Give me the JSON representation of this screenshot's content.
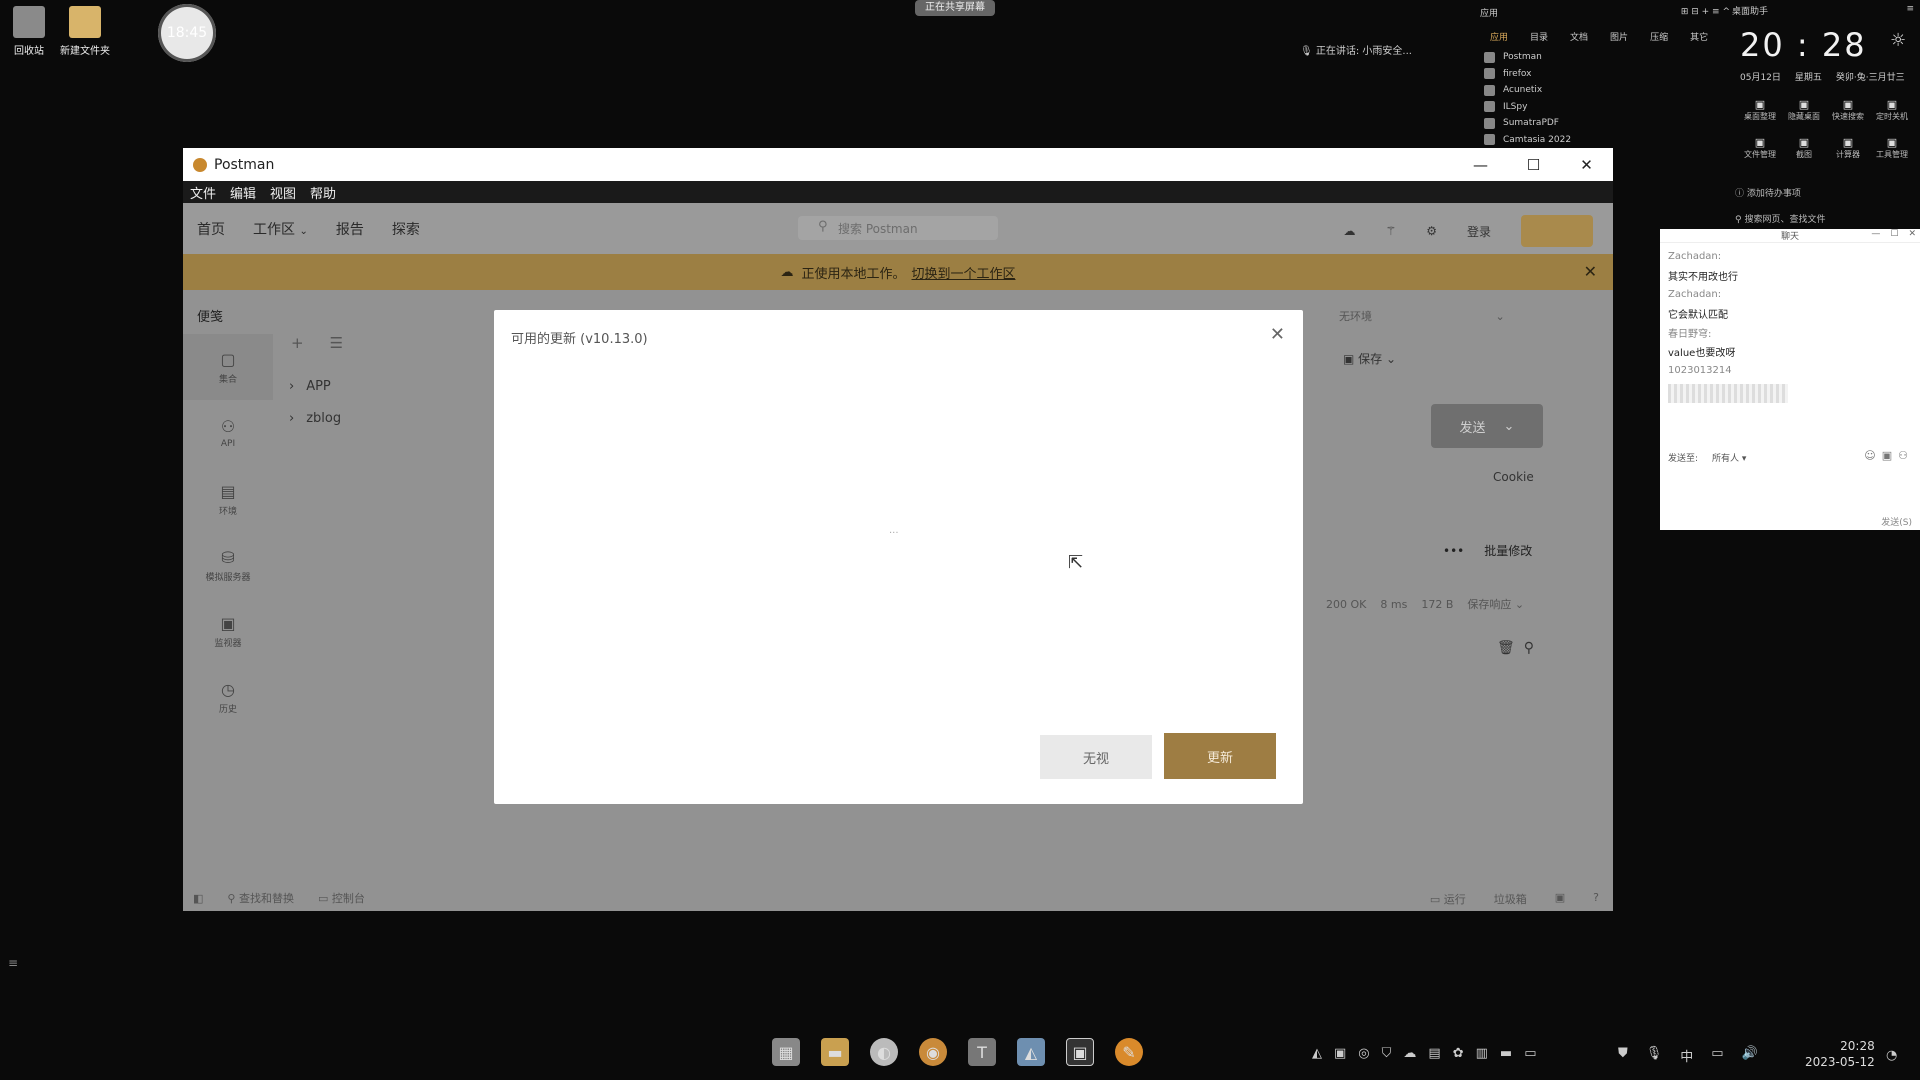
{
  "desktop": {
    "icons": [
      {
        "label": "回收站",
        "icon": "recycle-bin-icon"
      },
      {
        "label": "新建文件夹",
        "icon": "folder-icon"
      }
    ],
    "clock_widget": "18:45",
    "top_badge": "正在共享屏幕",
    "status_text": "正在讲话: 小雨安全..."
  },
  "launcher": {
    "title": "应用",
    "categories": [
      "应用",
      "目录",
      "文档",
      "图片",
      "压缩",
      "其它"
    ],
    "apps": [
      "Postman",
      "firefox",
      "Acunetix",
      "ILSpy",
      "SumatraPDF",
      "Camtasia 2022"
    ]
  },
  "sys_panel": {
    "title": "桌面助手",
    "time": "20 : 28",
    "date": "05月12日",
    "weekday": "星期五",
    "lunar": "癸卯·兔·三月廿三",
    "quick_row1": [
      "桌面整理",
      "隐藏桌面",
      "快速搜索",
      "定时关机"
    ],
    "quick_row2": [
      "文件管理",
      "截图",
      "计算器",
      "工具管理"
    ],
    "todo": "添加待办事项",
    "search": "搜索网页、查找文件"
  },
  "chat": {
    "title": "聊天",
    "messages": [
      {
        "text": "Zachadan:",
        "type": "name"
      },
      {
        "text": "其实不用改也行",
        "type": "msg"
      },
      {
        "text": "Zachadan:",
        "type": "name"
      },
      {
        "text": "它会默认匹配",
        "type": "msg"
      },
      {
        "text": "春日野穹:",
        "type": "name"
      },
      {
        "text": "value也要改呀",
        "type": "msg"
      },
      {
        "text": "1023013214",
        "type": "name"
      }
    ],
    "send_to_label": "发送至:",
    "send_to_value": "所有人",
    "send_button": "发送(S)"
  },
  "postman": {
    "title": "Postman",
    "menu": [
      "文件",
      "编辑",
      "视图",
      "帮助"
    ],
    "nav": [
      "首页",
      "工作区",
      "报告",
      "探索"
    ],
    "search_placeholder": "搜索 Postman",
    "login": "登录",
    "banner_text": "正使用本地工作。",
    "banner_link": "切换到一个工作区",
    "sidebar_title": "便笺",
    "rail": [
      {
        "label": "集合",
        "icon": "collection-icon"
      },
      {
        "label": "API",
        "icon": "api-icon"
      },
      {
        "label": "环境",
        "icon": "environment-icon"
      },
      {
        "label": "模拟服务器",
        "icon": "mock-server-icon"
      },
      {
        "label": "监视器",
        "icon": "monitor-icon"
      },
      {
        "label": "历史",
        "icon": "history-icon"
      }
    ],
    "tree": [
      "APP",
      "zblog"
    ],
    "env": "无环境",
    "save": "保存",
    "send": "发送",
    "cookie": "Cookie",
    "bulk_edit": "批量修改",
    "status": {
      "code": "200 OK",
      "time": "8 ms",
      "size": "172 B",
      "save_response": "保存响应"
    },
    "footer": {
      "find": "查找和替换",
      "console": "控制台",
      "runner": "运行",
      "trash": "垃圾箱"
    }
  },
  "modal": {
    "title": "可用的更新 (v10.13.0)",
    "spinner": "...",
    "ignore_label": "无视",
    "update_label": "更新"
  },
  "taskbar": {
    "ime": "中",
    "time": "20:28",
    "date": "2023-05-12"
  }
}
